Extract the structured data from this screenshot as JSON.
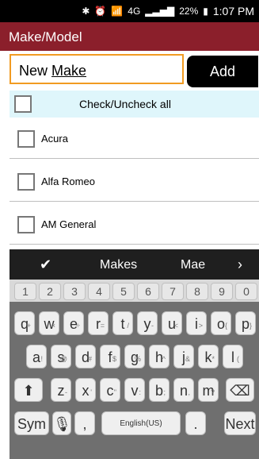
{
  "status": {
    "battery": "22%",
    "time": "1:07 PM",
    "network": "4G"
  },
  "appbar": {
    "title": "Make/Model"
  },
  "input": {
    "value_prefix": "New ",
    "value_underlined": "Make"
  },
  "add_button": {
    "label": "Add"
  },
  "checkall": {
    "label": "Check/Uncheck all"
  },
  "list": {
    "items": [
      "Acura",
      "Alfa Romeo",
      "AM General"
    ]
  },
  "keyboard": {
    "suggestions": [
      "Makes",
      "Mae"
    ],
    "numbers": [
      "1",
      "2",
      "3",
      "4",
      "5",
      "6",
      "7",
      "8",
      "9",
      "0"
    ],
    "row1": [
      "q",
      "w",
      "e",
      "r",
      "t",
      "y",
      "u",
      "i",
      "o",
      "p"
    ],
    "row1_sup": [
      "+",
      "×",
      "÷",
      "=",
      "/",
      "-",
      "<",
      ">",
      "{",
      "}"
    ],
    "row2": [
      "a",
      "s",
      "d",
      "f",
      "g",
      "h",
      "j",
      "k",
      "l"
    ],
    "row2_sup": [
      "!",
      "@",
      "#",
      "$",
      "%",
      "^",
      "&",
      "*",
      "("
    ],
    "row3": [
      "z",
      "x",
      "c",
      "v",
      "b",
      "n",
      "m"
    ],
    "row3_sup": [
      "-",
      "'",
      "\"",
      ":",
      ";",
      ",",
      "?"
    ],
    "sym_label": "Sym",
    "comma": ",",
    "space_label": "English(US)",
    "period": ".",
    "next_label": "Next"
  }
}
